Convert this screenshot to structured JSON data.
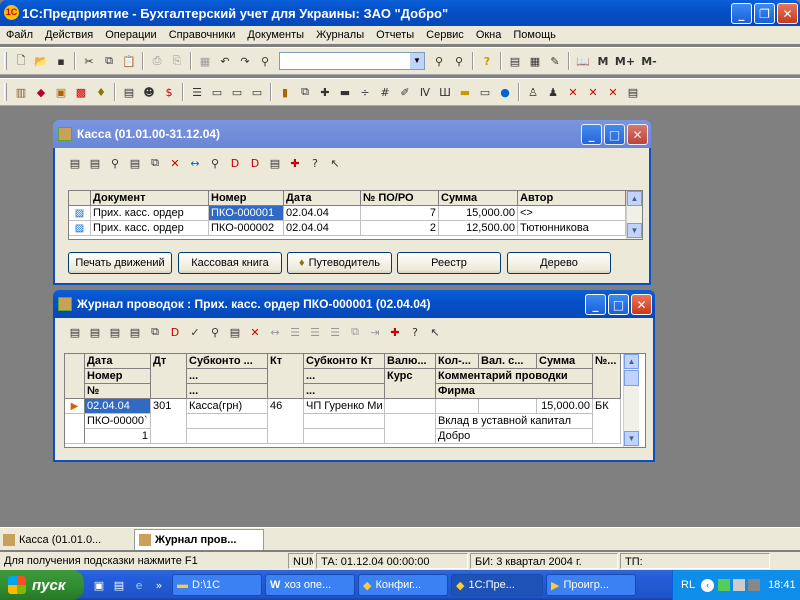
{
  "app": {
    "title": "1С:Предприятие - Бухгалтерский учет для Украины: ЗАО \"Добро\""
  },
  "menu": [
    "Файл",
    "Действия",
    "Операции",
    "Справочники",
    "Документы",
    "Журналы",
    "Отчеты",
    "Сервис",
    "Окна",
    "Помощь"
  ],
  "toolbar": {
    "m": "M",
    "mplus": "M+",
    "mminus": "M-"
  },
  "kassa": {
    "title": "Касса (01.01.00-31.12.04)",
    "columns": [
      "Документ",
      "Номер",
      "Дата",
      "№ ПО/РО",
      "Сумма",
      "Автор"
    ],
    "rows": [
      [
        "Прих. касс. ордер",
        "ПКО-000001",
        "02.04.04",
        "7",
        "15,000.00",
        "<>"
      ],
      [
        "Прих. касс. ордер",
        "ПКО-000002",
        "02.04.04",
        "2",
        "12,500.00",
        "Тютюнникова"
      ]
    ],
    "buttons": [
      "Печать движений",
      "Кассовая книга",
      "Путеводитель",
      "Реестр",
      "Дерево"
    ]
  },
  "journal": {
    "title": "Журнал проводок : Прих. касс. ордер ПКО-000001 (02.04.04)",
    "headers": {
      "date": "Дата",
      "number": "Номер",
      "no": "№",
      "dt": "Дт",
      "sub_dt": "Субконто ...",
      "dots1": "...",
      "dots2": "...",
      "kt": "Кт",
      "sub_kt": "Субконто Кт",
      "dots3": "...",
      "dots4": "...",
      "val": "Валю...",
      "rate": "Курс",
      "qty": "Кол-...",
      "valsum": "Вал. с...",
      "sum": "Сумма",
      "comment": "Комментарий проводки",
      "firm": "Фирма",
      "nomer": "№..."
    },
    "row": {
      "date": "02.04.04",
      "doc": "ПКО-00000`",
      "num": "1",
      "dt": "301",
      "sub_dt": "Касса(грн)",
      "kt": "46",
      "sub_kt": "ЧП Гуренко Ми",
      "sum": "15,000.00",
      "nomer": "БК",
      "comment": "Вклад в уставной капитал",
      "firm": "Добро"
    }
  },
  "tabs": [
    "Касса (01.01.0...",
    "Журнал пров..."
  ],
  "status": {
    "hint": "Для получения подсказки нажмите F1",
    "num": "NUM",
    "ta": "ТА: 01.12.04  00:00:00",
    "bi": "БИ: 3 квартал 2004 г.",
    "tp": "ТП:"
  },
  "taskbar": {
    "start": "пуск",
    "items": [
      "D:\\1C",
      "хоз опе...",
      "Конфиг...",
      "1С:Пре...",
      "Проигр..."
    ],
    "lang": "RL",
    "time": "18:41"
  }
}
